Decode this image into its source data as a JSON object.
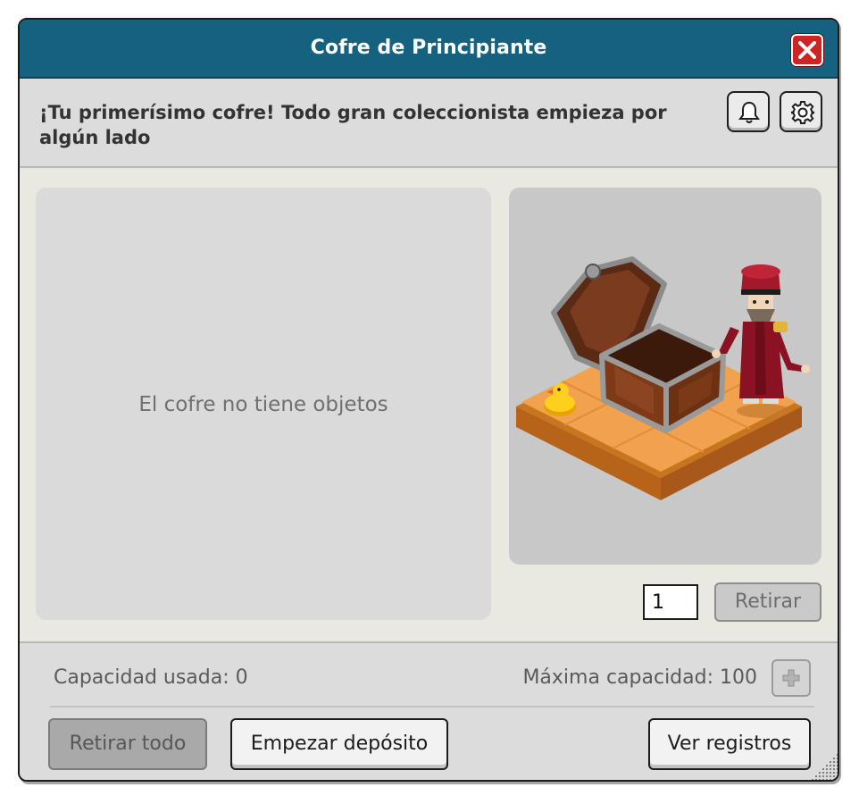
{
  "window": {
    "title": "Cofre de Principiante"
  },
  "header": {
    "description": "¡Tu primerísimo cofre! Todo gran coleccionista empieza por algún lado",
    "icons": [
      "bell-icon",
      "gear-icon"
    ]
  },
  "items": {
    "empty_text": "El cofre no tiene objetos"
  },
  "withdraw": {
    "quantity": "1",
    "button_label": "Retirar"
  },
  "capacity": {
    "used_label": "Capacidad usada: 0",
    "max_label": "Máxima capacidad: 100"
  },
  "actions": {
    "withdraw_all": "Retirar todo",
    "start_deposit": "Empezar depósito",
    "view_logs": "Ver registros"
  },
  "colors": {
    "titlebar": "#14627f",
    "close": "#cf2424",
    "background": "#e9e9e1"
  }
}
